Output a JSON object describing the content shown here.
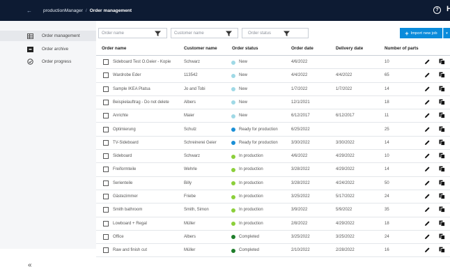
{
  "header": {
    "back_glyph": "←",
    "app_name": "productionManager",
    "separator": "/",
    "page_title": "Order management",
    "help_glyph": "?",
    "avatar_letter": "H"
  },
  "sidebar": {
    "items": [
      {
        "label": "Order management",
        "icon": "table-icon",
        "active": true
      },
      {
        "label": "Order archive",
        "icon": "archive-icon",
        "active": false
      },
      {
        "label": "Order progress",
        "icon": "progress-icon",
        "active": false
      }
    ],
    "collapse_glyph": "«"
  },
  "filters": [
    {
      "placeholder": "Order name"
    },
    {
      "placeholder": "Customer name"
    },
    {
      "placeholder": "Order status"
    }
  ],
  "actions": {
    "import_label": "Import new job",
    "plus_glyph": "+",
    "dropdown_glyph": "▾"
  },
  "table": {
    "columns": [
      "Order name",
      "Customer name",
      "Order status",
      "Order date",
      "Delivery date",
      "Number of parts"
    ],
    "rows": [
      {
        "name": "Sideboard Test O.Geier - Kopie",
        "customer": "Schwarz",
        "status": "New",
        "status_color": "#9fd9e6",
        "order_date": "4/6/2022",
        "delivery_date": "",
        "parts": "10"
      },
      {
        "name": "Wardrobe Eder",
        "customer": "113542",
        "status": "New",
        "status_color": "#9fd9e6",
        "order_date": "4/4/2022",
        "delivery_date": "4/4/2022",
        "parts": "65"
      },
      {
        "name": "Sample IKEA Platsa",
        "customer": "Jo and Tobi",
        "status": "New",
        "status_color": "#9fd9e6",
        "order_date": "1/7/2022",
        "delivery_date": "1/7/2022",
        "parts": "14"
      },
      {
        "name": "Beispielauftrag - Do not delete",
        "customer": "Albers",
        "status": "New",
        "status_color": "#9fd9e6",
        "order_date": "12/1/2021",
        "delivery_date": "",
        "parts": "18"
      },
      {
        "name": "Anrichte",
        "customer": "Maier",
        "status": "New",
        "status_color": "#9fd9e6",
        "order_date": "6/12/2017",
        "delivery_date": "6/12/2017",
        "parts": "11"
      },
      {
        "name": "Optimierung",
        "customer": "Schulz",
        "status": "Ready for production",
        "status_color": "#1a8fd6",
        "order_date": "6/25/2022",
        "delivery_date": "",
        "parts": "25"
      },
      {
        "name": "TV-Sideboard",
        "customer": "Schreinerei Geier",
        "status": "Ready for production",
        "status_color": "#1a8fd6",
        "order_date": "3/30/2022",
        "delivery_date": "3/30/2022",
        "parts": "14"
      },
      {
        "name": "Sideboard",
        "customer": "Schwarz",
        "status": "In production",
        "status_color": "#8bcf3a",
        "order_date": "4/6/2022",
        "delivery_date": "4/29/2022",
        "parts": "10"
      },
      {
        "name": "Freiformteile",
        "customer": "Wehrle",
        "status": "In production",
        "status_color": "#8bcf3a",
        "order_date": "3/28/2022",
        "delivery_date": "4/29/2022",
        "parts": "14"
      },
      {
        "name": "Serienteile",
        "customer": "Billy",
        "status": "In production",
        "status_color": "#8bcf3a",
        "order_date": "3/28/2022",
        "delivery_date": "4/24/2022",
        "parts": "50"
      },
      {
        "name": "Gästezimmer",
        "customer": "Friebe",
        "status": "In production",
        "status_color": "#8bcf3a",
        "order_date": "3/25/2022",
        "delivery_date": "5/17/2022",
        "parts": "24"
      },
      {
        "name": "Smith bathroom",
        "customer": "Smith, Simon",
        "status": "In production",
        "status_color": "#8bcf3a",
        "order_date": "3/9/2022",
        "delivery_date": "5/9/2022",
        "parts": "35"
      },
      {
        "name": "Lowboard + Regal",
        "customer": "Müller",
        "status": "In production",
        "status_color": "#8bcf3a",
        "order_date": "2/8/2022",
        "delivery_date": "4/29/2022",
        "parts": "18"
      },
      {
        "name": "Office",
        "customer": "Albers",
        "status": "Completed",
        "status_color": "#1e7d2a",
        "order_date": "3/25/2022",
        "delivery_date": "3/25/2022",
        "parts": "24"
      },
      {
        "name": "Raw and finish cut",
        "customer": "Müller",
        "status": "Completed",
        "status_color": "#1e7d2a",
        "order_date": "2/10/2022",
        "delivery_date": "2/28/2022",
        "parts": "16"
      }
    ]
  }
}
